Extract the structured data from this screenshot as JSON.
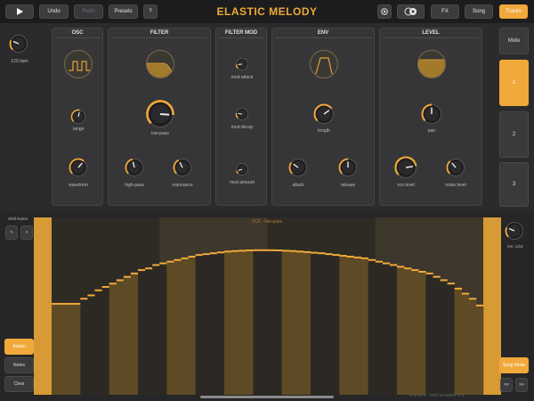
{
  "app": {
    "title": "ELASTIC MELODY",
    "accent_color": "#f0a93a"
  },
  "toolbar": {
    "play_icon": "play-icon",
    "undo_label": "Undo",
    "redo_label": "Redo",
    "presets_label": "Presets",
    "help_label": "?",
    "settings_icon": "gear-icon",
    "link_icon": "link-icon",
    "fx_label": "FX",
    "song_label": "Song",
    "tracks_label": "Tracks"
  },
  "tempo": {
    "label": "120 bpm"
  },
  "panels": {
    "osc": {
      "title": "OSC",
      "range_label": "range",
      "waveform_label": "waveform"
    },
    "filter": {
      "title": "FILTER",
      "lowpass_label": "low-pass",
      "highpass_label": "high-pass",
      "resonance_label": "resonance"
    },
    "filter_mod": {
      "title": "FILTER MOD",
      "mod_attack_label": "mod attack",
      "mod_decay_label": "mod decay",
      "mod_amount_label": "mod amount"
    },
    "env": {
      "title": "ENV",
      "length_label": "length",
      "attack_label": "attack",
      "release_label": "release"
    },
    "level": {
      "title": "LEVEL",
      "pan_label": "pan",
      "vco_level_label": "vco level",
      "noise_level_label": "noise level"
    }
  },
  "tracks": {
    "mute_label": "Mute",
    "items": [
      "1",
      "2",
      "3"
    ],
    "active_index": 0
  },
  "editor": {
    "shift_notes_label": "Shift Notes",
    "shift_left": "<",
    "shift_right": ">",
    "graph_title": "VCF - low-pass",
    "automation_label": "Autom",
    "notes_label": "Notes",
    "clear_label": "Clear",
    "len_label": "len: 1/16",
    "song_mode_label": "Song Mode",
    "prev_label": "<<",
    "next_label": ">>",
    "footer": "D-S-SUS - DOG BARBER | F1"
  },
  "automation_values": [
    0.54,
    0.54,
    0.54,
    0.54,
    0.57,
    0.59,
    0.62,
    0.64,
    0.66,
    0.68,
    0.7,
    0.72,
    0.74,
    0.75,
    0.77,
    0.78,
    0.79,
    0.8,
    0.81,
    0.82,
    0.83,
    0.835,
    0.84,
    0.845,
    0.85,
    0.853,
    0.855,
    0.857,
    0.858,
    0.858,
    0.858,
    0.857,
    0.855,
    0.853,
    0.85,
    0.847,
    0.843,
    0.84,
    0.835,
    0.83,
    0.825,
    0.82,
    0.815,
    0.81,
    0.8,
    0.79,
    0.78,
    0.77,
    0.76,
    0.75,
    0.74,
    0.73,
    0.72,
    0.7,
    0.68,
    0.66,
    0.63,
    0.6,
    0.57,
    0.53
  ],
  "knobs": {
    "tempo": 0.25,
    "range": 0.55,
    "waveform": 0.65,
    "lowpass": 0.85,
    "highpass": 0.45,
    "resonance": 0.4,
    "mod_attack": 0.15,
    "mod_decay": 0.2,
    "mod_amount": 0.1,
    "length": 0.7,
    "attack": 0.3,
    "release": 0.5,
    "pan": 0.5,
    "vco_level": 0.8,
    "noise_level": 0.35,
    "len": 0.25
  }
}
